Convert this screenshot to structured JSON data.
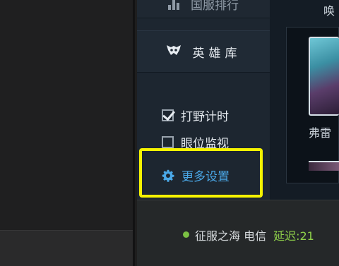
{
  "nav": {
    "rank_label": "国服排行",
    "hero_library_label": "英雄库"
  },
  "options": {
    "jungle_timer_label": "打野计时",
    "jungle_timer_checked": true,
    "ward_monitor_label": "眼位监视",
    "ward_monitor_checked": false,
    "more_settings_label": "更多设置"
  },
  "right_panel": {
    "summon_label": "唤",
    "hero_name": "弗雷"
  },
  "status": {
    "server": "征服之海 电信",
    "latency": "延迟:21"
  },
  "colors": {
    "highlight": "#f5f200",
    "link": "#4aa8e8",
    "online": "#7bc043"
  }
}
